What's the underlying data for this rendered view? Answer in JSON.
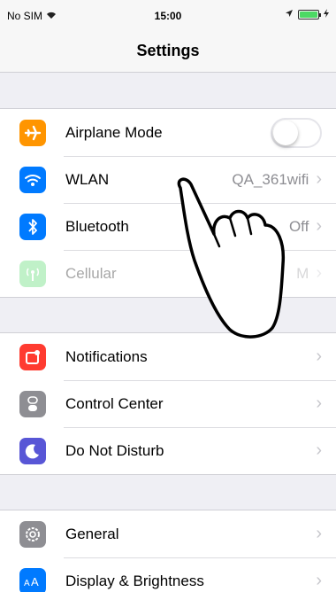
{
  "status": {
    "carrier": "No SIM",
    "time": "15:00"
  },
  "nav": {
    "title": "Settings"
  },
  "group1": [
    {
      "label": "Airplane Mode",
      "icon": "airplane-icon",
      "color": "#ff9500",
      "toggle": "off"
    },
    {
      "label": "WLAN",
      "value": "QA_361wifi",
      "icon": "wifi-icon",
      "color": "#007aff"
    },
    {
      "label": "Bluetooth",
      "value": "Off",
      "icon": "bluetooth-icon",
      "color": "#007aff"
    },
    {
      "label": "Cellular",
      "value": "M",
      "icon": "cellular-icon",
      "color": "#4cd964",
      "disabled": true
    }
  ],
  "group2": [
    {
      "label": "Notifications",
      "icon": "notifications-icon",
      "color": "#ff3b30"
    },
    {
      "label": "Control Center",
      "icon": "control-center-icon",
      "color": "#8e8e93"
    },
    {
      "label": "Do Not Disturb",
      "icon": "moon-icon",
      "color": "#5856d6"
    }
  ],
  "group3": [
    {
      "label": "General",
      "icon": "gear-icon",
      "color": "#8e8e93"
    },
    {
      "label": "Display & Brightness",
      "icon": "display-icon",
      "color": "#007aff"
    }
  ],
  "overlay": {
    "icon": "pointing-hand-icon"
  }
}
